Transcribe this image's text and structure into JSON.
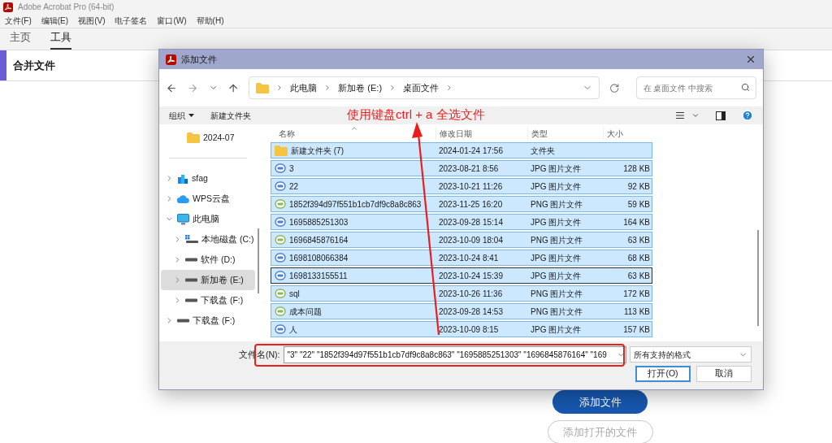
{
  "app": {
    "title": "Adobe Acrobat Pro (64-bit)",
    "menu": [
      "文件(F)",
      "编辑(E)",
      "视图(V)",
      "电子签名",
      "窗口(W)",
      "帮助(H)"
    ],
    "tabs": [
      {
        "label": "主页",
        "selected": false
      },
      {
        "label": "工具",
        "selected": true
      }
    ],
    "tool_header": "合并文件",
    "buttons": [
      {
        "label": "添加文件",
        "kind": "primary"
      },
      {
        "label": "添加打开的文件",
        "kind": "secondary"
      }
    ]
  },
  "dialog": {
    "title": "添加文件",
    "breadcrumb": [
      "此电脑",
      "新加卷 (E:)",
      "桌面文件"
    ],
    "search": {
      "placeholder": "在 桌面文件 中搜索"
    },
    "toolbar": [
      {
        "label": "组织",
        "kind": "menu"
      },
      {
        "label": "新建文件夹",
        "kind": "plain"
      }
    ],
    "sidebar": [
      {
        "label": "2024-07",
        "kind": "folder",
        "selected": false
      },
      {
        "label": "sfag",
        "kind": "onedrive",
        "selected": false,
        "expanded": false
      },
      {
        "label": "WPS云盘",
        "kind": "cloud",
        "selected": false,
        "expanded": false
      },
      {
        "label": "此电脑",
        "kind": "computer",
        "selected": false,
        "expanded": true,
        "children": [
          {
            "label": "本地磁盘 (C:)",
            "kind": "system-drive",
            "selected": false,
            "expanded": false
          },
          {
            "label": "软件 (D:)",
            "kind": "drive",
            "selected": false,
            "expanded": false
          },
          {
            "label": "新加卷 (E:)",
            "kind": "drive",
            "selected": true,
            "expanded": false
          },
          {
            "label": "下载盘 (F:)",
            "kind": "drive",
            "selected": false,
            "expanded": false
          }
        ]
      },
      {
        "label": "下载盘 (F:)",
        "kind": "drive",
        "selected": false,
        "expanded": false
      }
    ],
    "columns": [
      "名称",
      "修改日期",
      "类型",
      "大小"
    ],
    "rows": [
      {
        "name": "新建文件夹 (7)",
        "date": "2024-01-24 17:56",
        "type": "文件夹",
        "size": "",
        "kind": "folder",
        "selected": true,
        "focused": false
      },
      {
        "name": "3",
        "date": "2023-08-21 8:56",
        "type": "JPG 图片文件",
        "size": "128 KB",
        "kind": "jpg",
        "selected": true,
        "focused": false
      },
      {
        "name": "22",
        "date": "2023-10-21 11:26",
        "type": "JPG 图片文件",
        "size": "92 KB",
        "kind": "jpg",
        "selected": true,
        "focused": false
      },
      {
        "name": "1852f394d97f551b1cb7df9c8a8c863",
        "date": "2023-11-25 16:20",
        "type": "PNG 图片文件",
        "size": "59 KB",
        "kind": "png",
        "selected": true,
        "focused": false
      },
      {
        "name": "1695885251303",
        "date": "2023-09-28 15:14",
        "type": "JPG 图片文件",
        "size": "164 KB",
        "kind": "jpg",
        "selected": true,
        "focused": false
      },
      {
        "name": "1696845876164",
        "date": "2023-10-09 18:04",
        "type": "PNG 图片文件",
        "size": "63 KB",
        "kind": "png",
        "selected": true,
        "focused": false
      },
      {
        "name": "1698108066384",
        "date": "2023-10-24 8:41",
        "type": "JPG 图片文件",
        "size": "68 KB",
        "kind": "jpg",
        "selected": true,
        "focused": false
      },
      {
        "name": "1698133155511",
        "date": "2023-10-24 15:39",
        "type": "JPG 图片文件",
        "size": "63 KB",
        "kind": "jpg",
        "selected": true,
        "focused": true
      },
      {
        "name": "sql",
        "date": "2023-10-26 11:36",
        "type": "PNG 图片文件",
        "size": "172 KB",
        "kind": "png",
        "selected": true,
        "focused": false
      },
      {
        "name": "成本问题",
        "date": "2023-09-28 14:53",
        "type": "PNG 图片文件",
        "size": "113 KB",
        "kind": "png",
        "selected": true,
        "focused": false
      },
      {
        "name": "人",
        "date": "2023-10-09 8:15",
        "type": "JPG 图片文件",
        "size": "157 KB",
        "kind": "jpg",
        "selected": true,
        "focused": false
      }
    ],
    "filename_label": "文件名(N):",
    "filename": {
      "value": "\"3\" \"22\" \"1852f394d97f551b1cb7df9c8a8c863\" \"1695885251303\" \"1696845876164\" \"169"
    },
    "filter": "所有支持的格式",
    "buttons": [
      {
        "label": "打开(O)",
        "kind": "primary"
      },
      {
        "label": "取消",
        "kind": "secondary"
      }
    ]
  },
  "annotation": {
    "text": "使用键盘ctrl + a 全选文件"
  }
}
